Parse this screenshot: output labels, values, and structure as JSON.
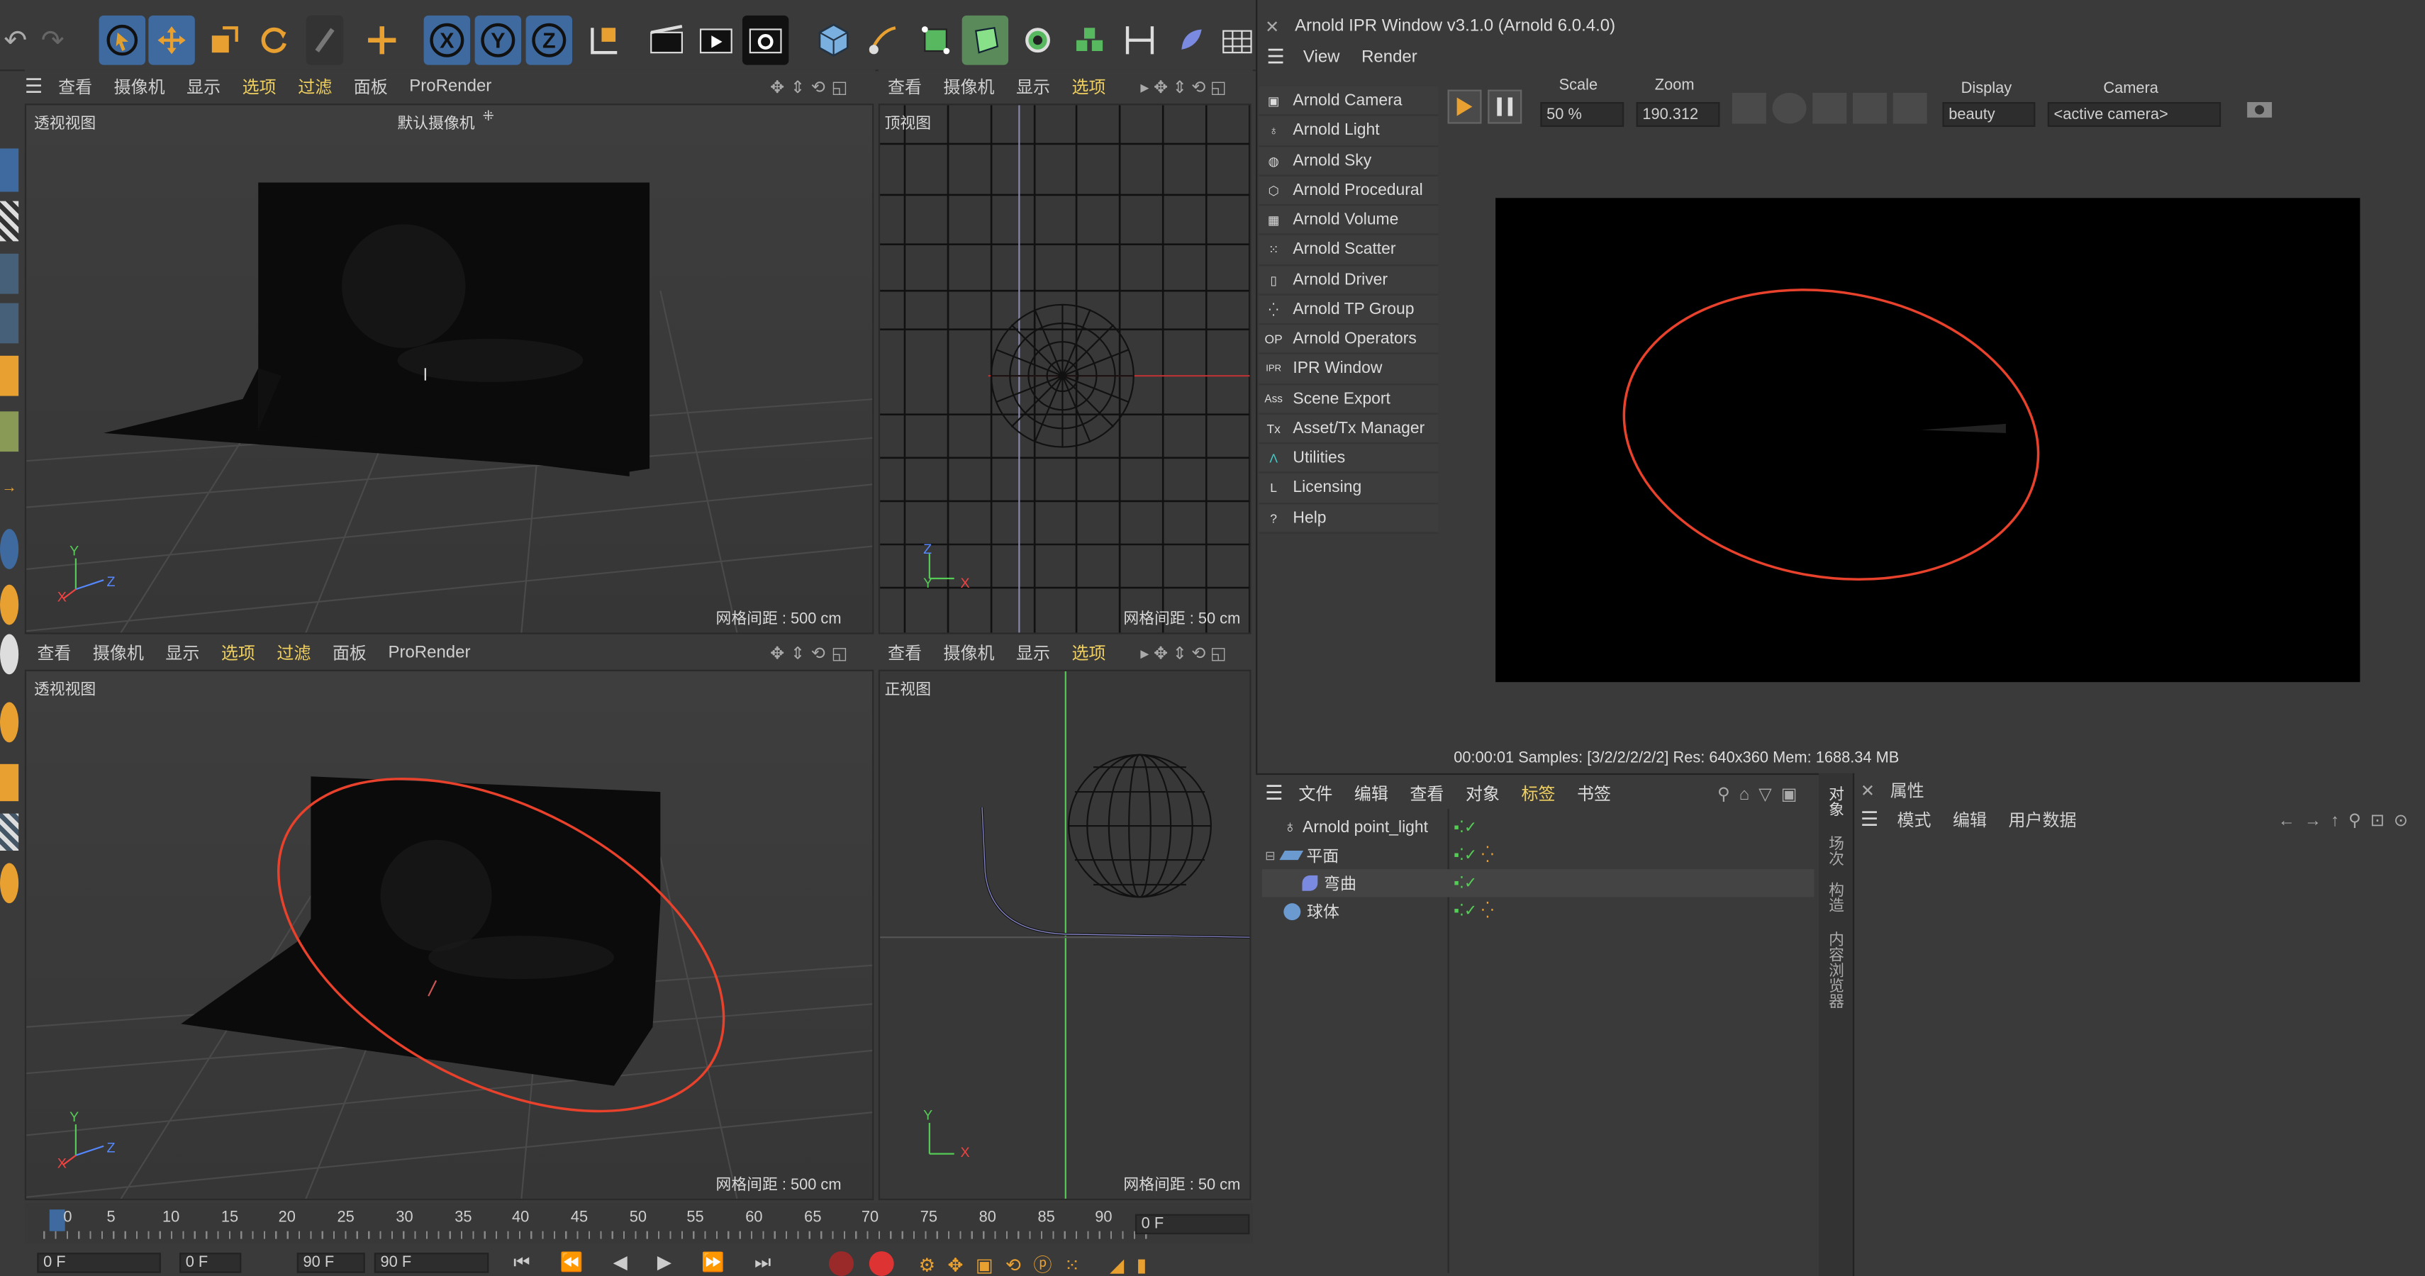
{
  "app": {
    "arnold_title": "Arnold IPR Window v3.1.0 (Arnold 6.0.4.0)"
  },
  "top_toolbar": {
    "icons": [
      "undo-icon",
      "redo-icon",
      "select-cursor-icon",
      "move-icon",
      "scale-icon",
      "rotate-icon",
      "recent-tools-icon",
      "live-select-icon",
      "x-axis-icon",
      "y-axis-icon",
      "z-axis-icon",
      "coordinate-system-icon",
      "render-view-icon",
      "render-picture-viewer-icon",
      "render-settings-icon",
      "cube-icon",
      "pen-icon",
      "subdivision-icon",
      "extrude-icon",
      "mograph-cloner-icon",
      "array-icon",
      "spline-icon",
      "deformer-icon",
      "floor-icon"
    ]
  },
  "viewports": {
    "top_left": {
      "menu": [
        "查看",
        "摄像机",
        "显示",
        "选项",
        "过滤",
        "面板",
        "ProRender"
      ],
      "label": "透视视图",
      "camera": "默认摄像机",
      "grid": "网格间距 : 500 cm"
    },
    "top_right": {
      "menu": [
        "查看",
        "摄像机",
        "显示",
        "选项"
      ],
      "label": "顶视图",
      "grid": "网格间距 : 50 cm"
    },
    "bottom_left": {
      "menu": [
        "查看",
        "摄像机",
        "显示",
        "选项",
        "过滤",
        "面板",
        "ProRender"
      ],
      "label": "透视视图",
      "grid": "网格间距 : 500 cm"
    },
    "bottom_right": {
      "menu": [
        "查看",
        "摄像机",
        "显示",
        "选项"
      ],
      "label": "正视图",
      "grid": "网格间距 : 50 cm"
    },
    "axes": {
      "x": "X",
      "y": "Y",
      "z": "Z"
    }
  },
  "arnold_menu": {
    "menubar": [
      "View",
      "Render"
    ],
    "items": [
      {
        "label": "Arnold Camera",
        "icon": "camera-icon",
        "glyph": "▣"
      },
      {
        "label": "Arnold Light",
        "icon": "bulb-icon",
        "glyph": "♁"
      },
      {
        "label": "Arnold Sky",
        "icon": "globe-icon",
        "glyph": "◍"
      },
      {
        "label": "Arnold Procedural",
        "icon": "cube-outline-icon",
        "glyph": "⬡"
      },
      {
        "label": "Arnold Volume",
        "icon": "volume-icon",
        "glyph": "▦"
      },
      {
        "label": "Arnold Scatter",
        "icon": "scatter-icon",
        "glyph": "⁙"
      },
      {
        "label": "Arnold Driver",
        "icon": "document-icon",
        "glyph": "▯"
      },
      {
        "label": "Arnold TP Group",
        "icon": "tp-group-icon",
        "glyph": "⁛"
      },
      {
        "label": "Arnold Operators",
        "icon": "operators-icon",
        "glyph": "OP"
      },
      {
        "label": "IPR Window",
        "icon": "ipr-icon",
        "glyph": "IPR"
      },
      {
        "label": "Scene Export",
        "icon": "ass-icon",
        "glyph": "Ass"
      },
      {
        "label": "Asset/Tx Manager",
        "icon": "tx-icon",
        "glyph": "Tx"
      },
      {
        "label": "Utilities",
        "icon": "arnold-logo-icon",
        "glyph": "Λ"
      },
      {
        "label": "Licensing",
        "icon": "licensing-icon",
        "glyph": "L"
      },
      {
        "label": "Help",
        "icon": "help-icon",
        "glyph": "?"
      }
    ]
  },
  "ipr": {
    "scale_label": "Scale",
    "scale_value": "50 %",
    "zoom_label": "Zoom",
    "zoom_value": "190.312",
    "display_label": "Display",
    "display_value": "beauty",
    "camera_label": "Camera",
    "camera_value": "<active camera>",
    "status": "00:00:01  Samples: [3/2/2/2/2/2]  Res: 640x360  Mem: 1688.34 MB"
  },
  "object_manager": {
    "menu": [
      "文件",
      "编辑",
      "查看",
      "对象",
      "标签",
      "书签"
    ],
    "objects": [
      {
        "name": "Arnold point_light",
        "icon": "bulb-icon"
      },
      {
        "name": "平面",
        "icon": "plane-icon"
      },
      {
        "name": "弯曲",
        "icon": "bend-deformer-icon"
      },
      {
        "name": "球体",
        "icon": "sphere-icon"
      }
    ],
    "side_tabs": [
      "对象",
      "场次",
      "构造",
      "内容浏览器"
    ]
  },
  "attributes": {
    "title": "属性",
    "menu": [
      "模式",
      "编辑",
      "用户数据"
    ]
  },
  "timeline": {
    "ticks": [
      "0",
      "5",
      "10",
      "15",
      "20",
      "25",
      "30",
      "35",
      "40",
      "45",
      "50",
      "55",
      "60",
      "65",
      "70",
      "75",
      "80",
      "85",
      "90"
    ],
    "current_frame": "0 F",
    "fields": [
      "0 F",
      "0 F",
      "90 F",
      "90 F"
    ]
  },
  "colors": {
    "accent_blue": "#3e6aa0",
    "annotation_red": "#e8412c",
    "menu_yellow": "#f0d060"
  }
}
